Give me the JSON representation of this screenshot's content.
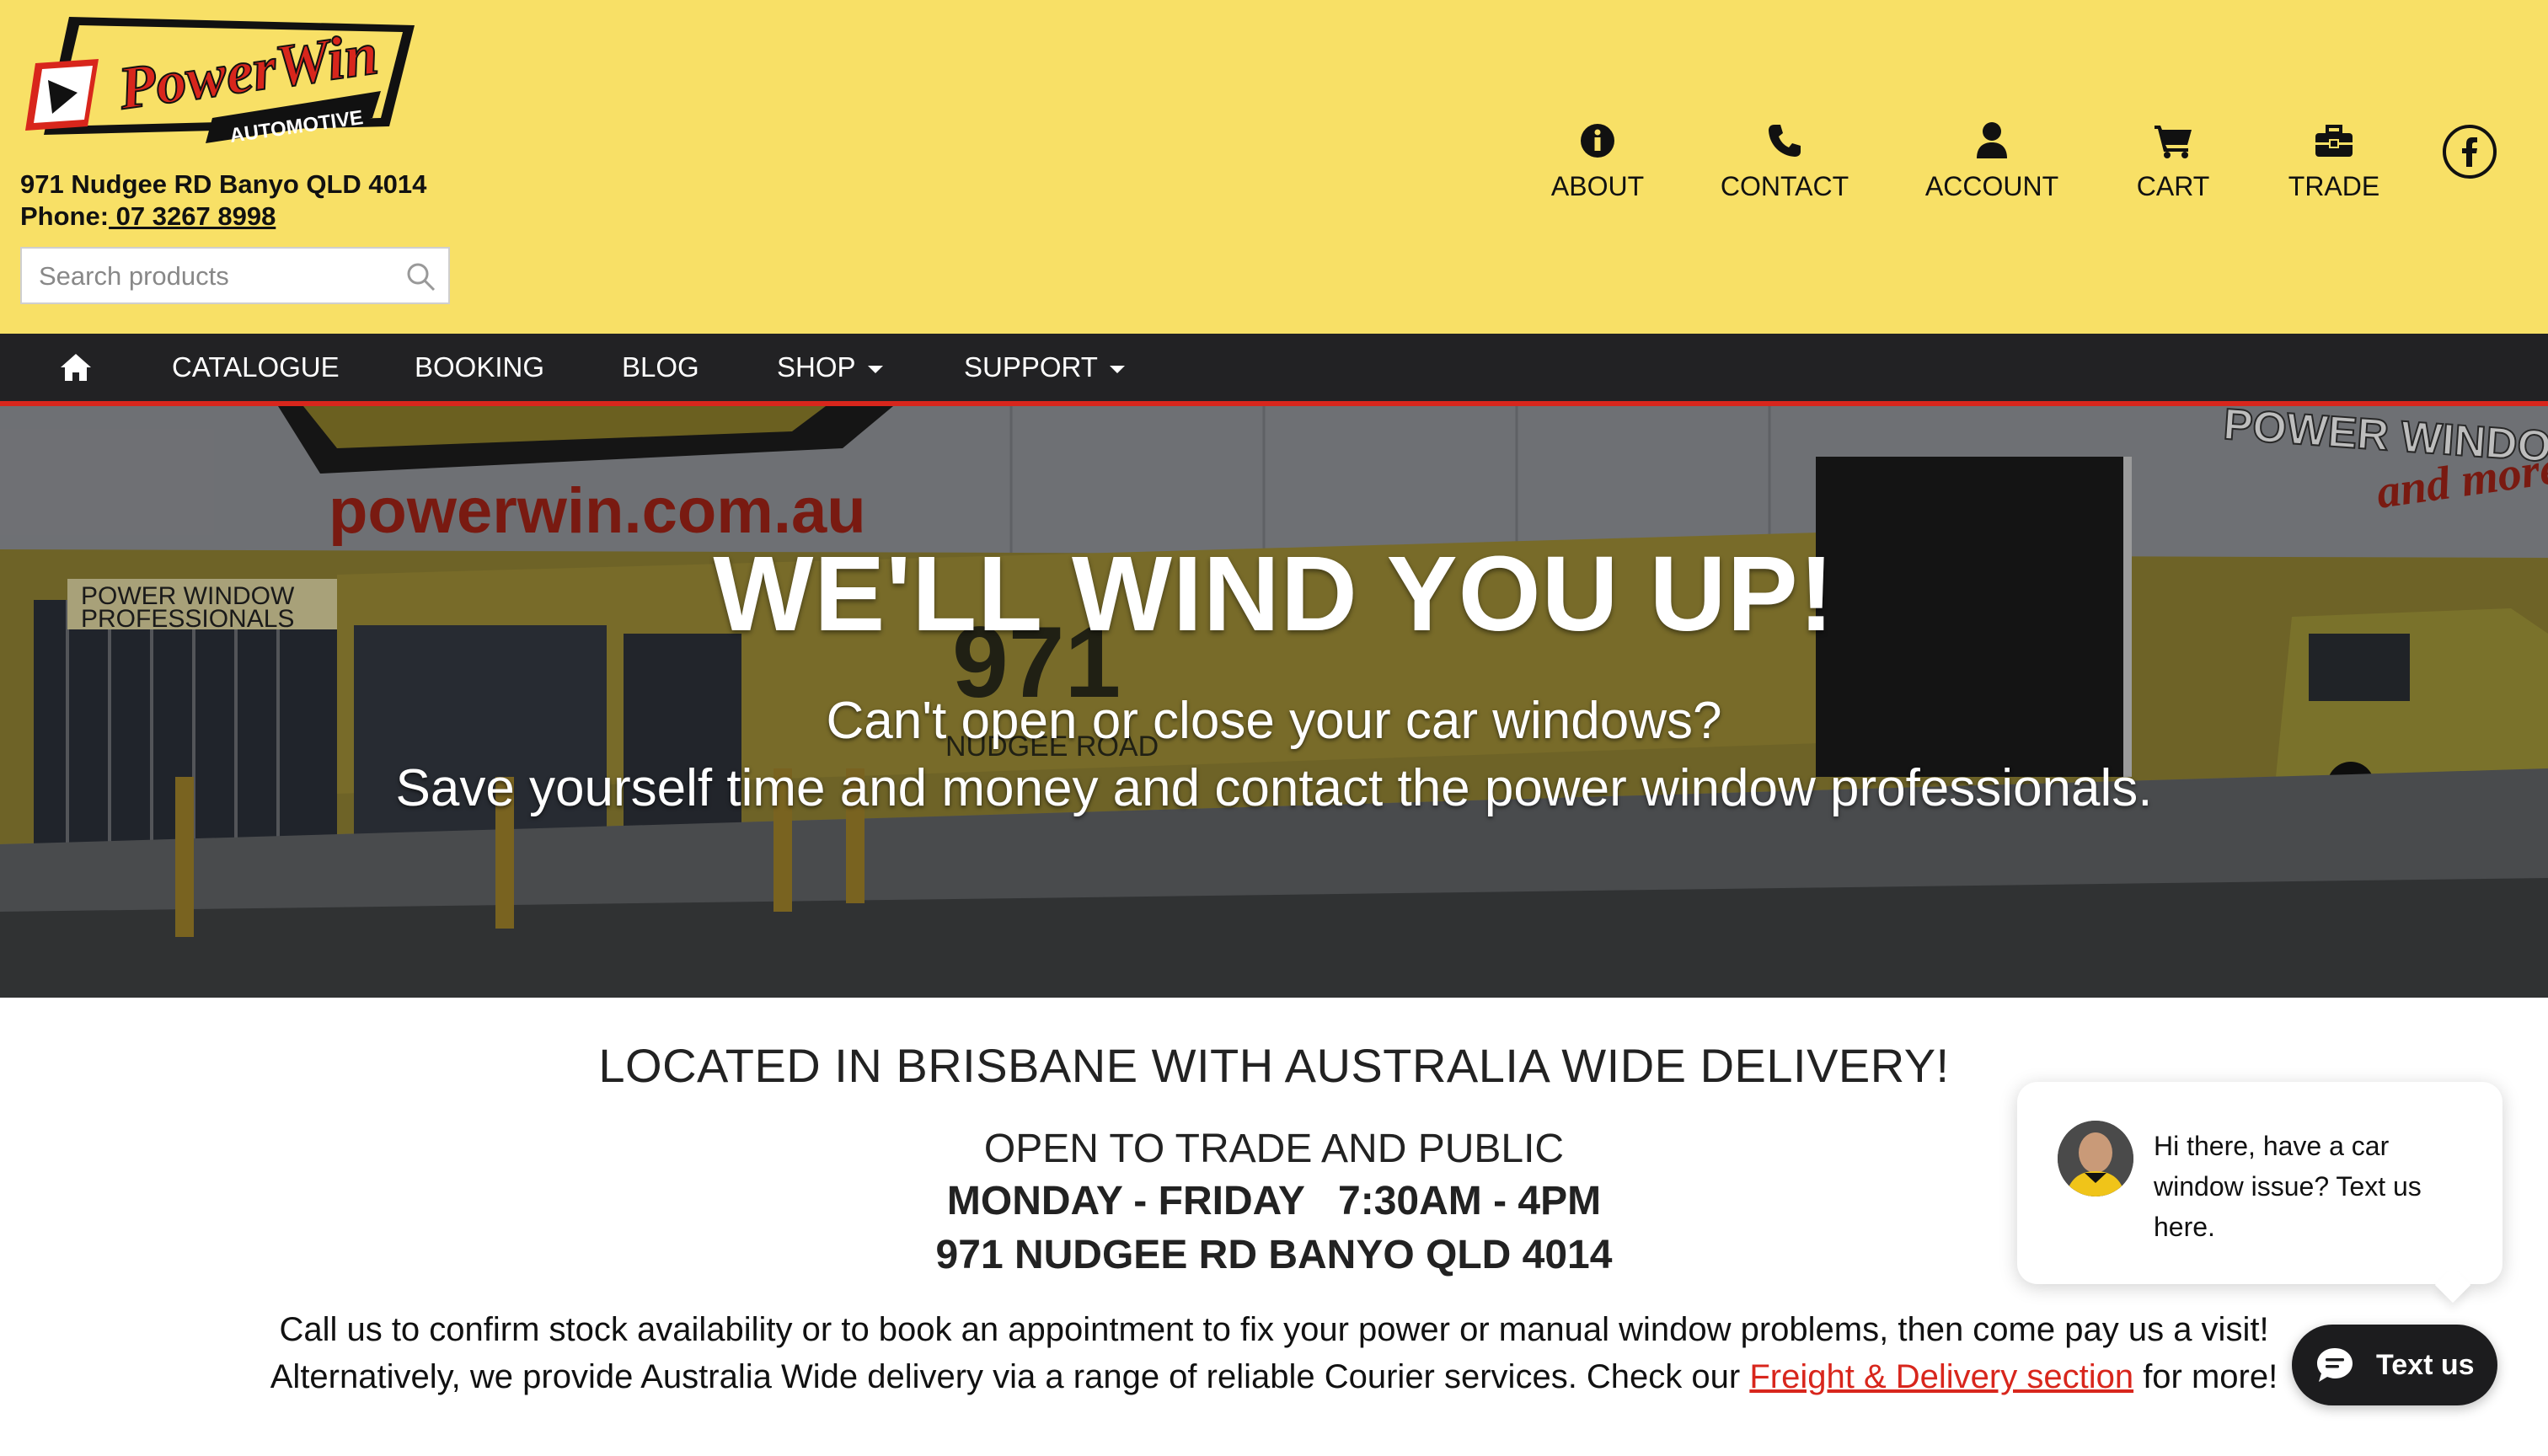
{
  "brand": {
    "logo_text": "PowerWin",
    "logo_subtext": "AUTOMOTIVE",
    "address": "971 Nudgee RD Banyo QLD 4014",
    "phone_label": "Phone:",
    "phone_number": " 07 3267 8998"
  },
  "search": {
    "placeholder": "Search products",
    "icon": "search-icon"
  },
  "top_nav": [
    {
      "label": "ABOUT",
      "icon": "info-icon"
    },
    {
      "label": "CONTACT",
      "icon": "phone-icon"
    },
    {
      "label": "ACCOUNT",
      "icon": "user-icon"
    },
    {
      "label": "CART",
      "icon": "cart-icon"
    },
    {
      "label": "TRADE",
      "icon": "toolbox-icon"
    }
  ],
  "social": {
    "icon": "facebook-icon"
  },
  "main_nav": [
    {
      "label": "CATALOGUE"
    },
    {
      "label": "BOOKING"
    },
    {
      "label": "BLOG"
    },
    {
      "label": "SHOP",
      "dropdown": true
    },
    {
      "label": "SUPPORT",
      "dropdown": true
    }
  ],
  "hero": {
    "title": "WE'LL WIND YOU UP!",
    "line1": "Can't open or close your car windows?",
    "line2": "Save yourself time and money and contact the power window professionals.",
    "photo_text": {
      "website": "powerwin.com.au",
      "sign_left_1": "POWER WINDOW",
      "sign_left_2": "PROFESSIONALS",
      "street_number": "971",
      "street_name": "NUDGEE ROAD",
      "sign_right_1": "POWER WINDOWS",
      "sign_right_2": "and more!"
    }
  },
  "content": {
    "heading": "LOCATED IN BRISBANE WITH AUSTRALIA WIDE DELIVERY!",
    "subheading": "OPEN TO TRADE AND PUBLIC",
    "hours": "MONDAY - FRIDAY   7:30AM - 4PM",
    "address": "971 NUDGEE RD BANYO QLD 4014",
    "para1": "Call us to confirm stock availability or to book an appointment to fix your power or manual window problems, then come pay us a visit!",
    "para2_before": "Alternatively, we provide Australia Wide delivery via a range of reliable Courier services. Check our ",
    "para2_link": "Freight & Delivery section",
    "para2_after": " for more!"
  },
  "chat": {
    "message": "Hi there, have a car window issue? Text us here.",
    "button_label": "Text us"
  },
  "colors": {
    "header_bg": "#f8e066",
    "nav_bg": "#222224",
    "accent_red": "#d8261c"
  }
}
